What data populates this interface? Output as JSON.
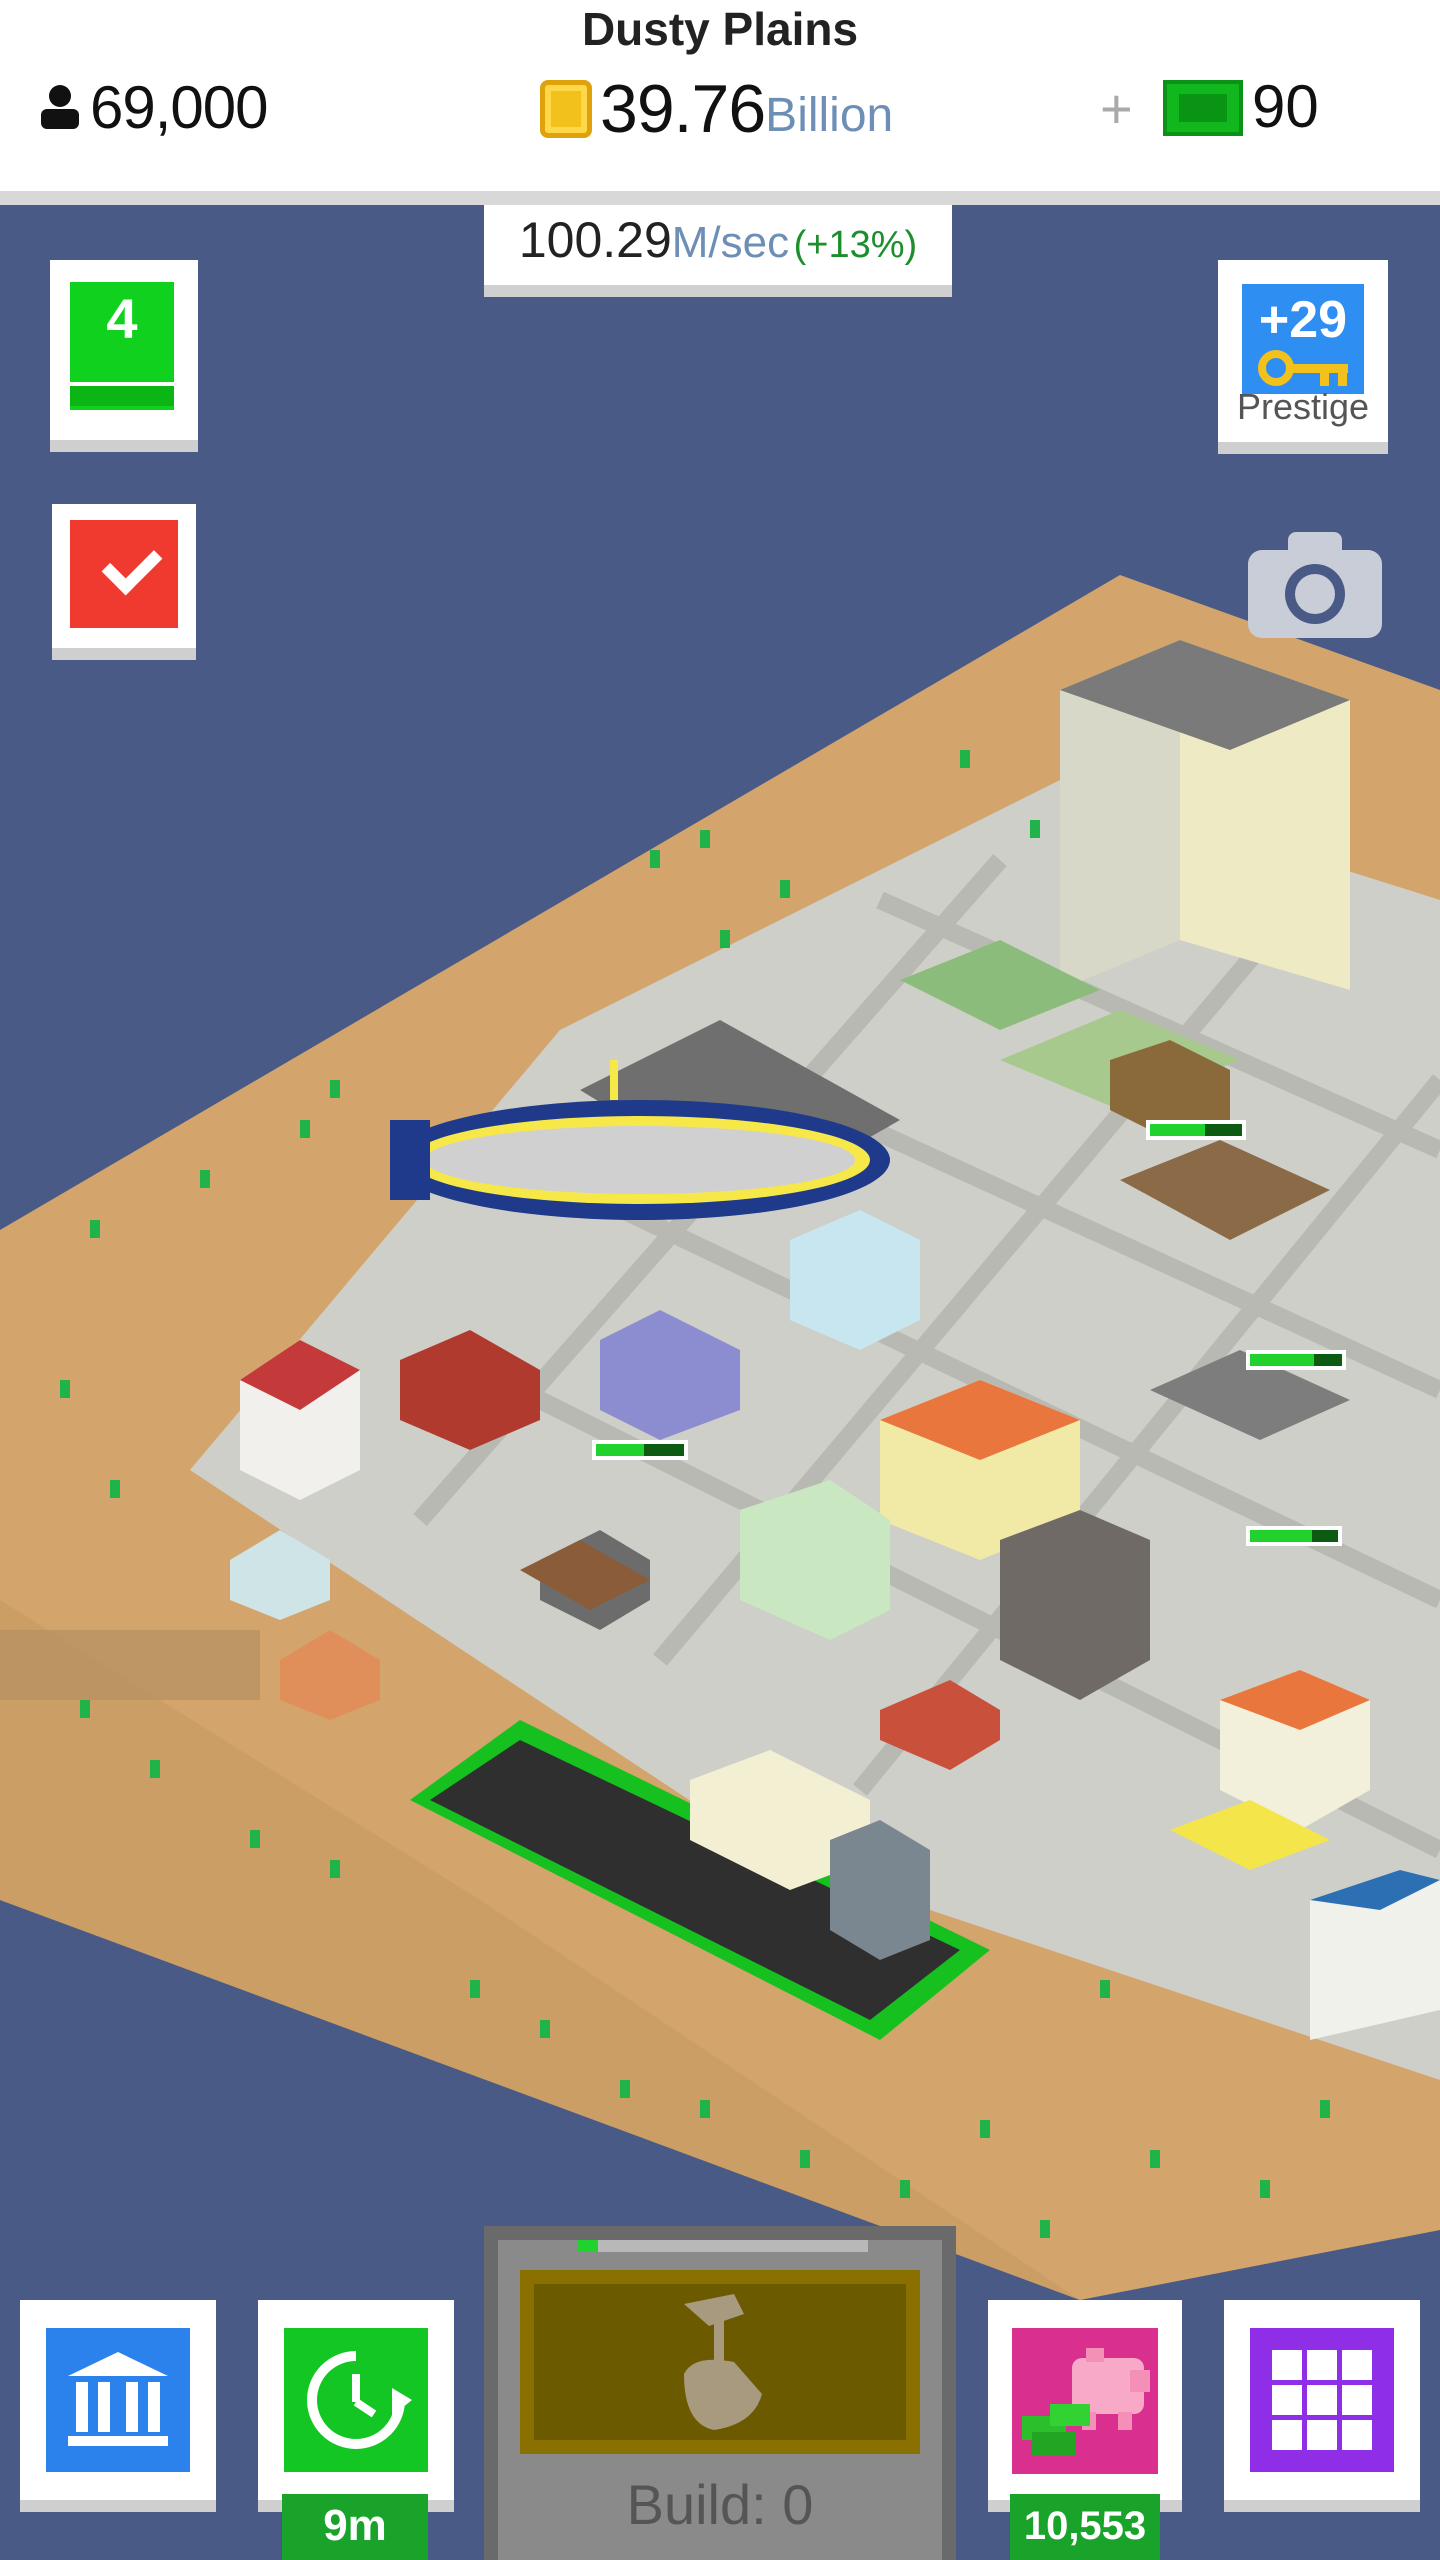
{
  "hud": {
    "city_name": "Dusty Plains",
    "population": "69,000",
    "money_amount": "39.76",
    "money_unit": "Billion",
    "cash_plus": "+",
    "cash_count": "90",
    "rate_value": "100.29",
    "rate_unit": "M/sec",
    "rate_bonus": "(+13%)"
  },
  "side": {
    "level": "4",
    "prestige_value": "+29",
    "prestige_label": "Prestige"
  },
  "bottom": {
    "timer_label": "9m",
    "build_label": "Build: 0",
    "build_progress": 0.07,
    "piggy_amount": "10,553"
  },
  "map_bars": [
    0.6,
    0.7,
    0.55,
    0.7
  ],
  "colors": {
    "water": "#4a5a86",
    "sand": "#d3a56c",
    "road": "#cfcfc9",
    "green": "#10d21e",
    "red": "#f03a30",
    "blue": "#2f8ef2"
  }
}
